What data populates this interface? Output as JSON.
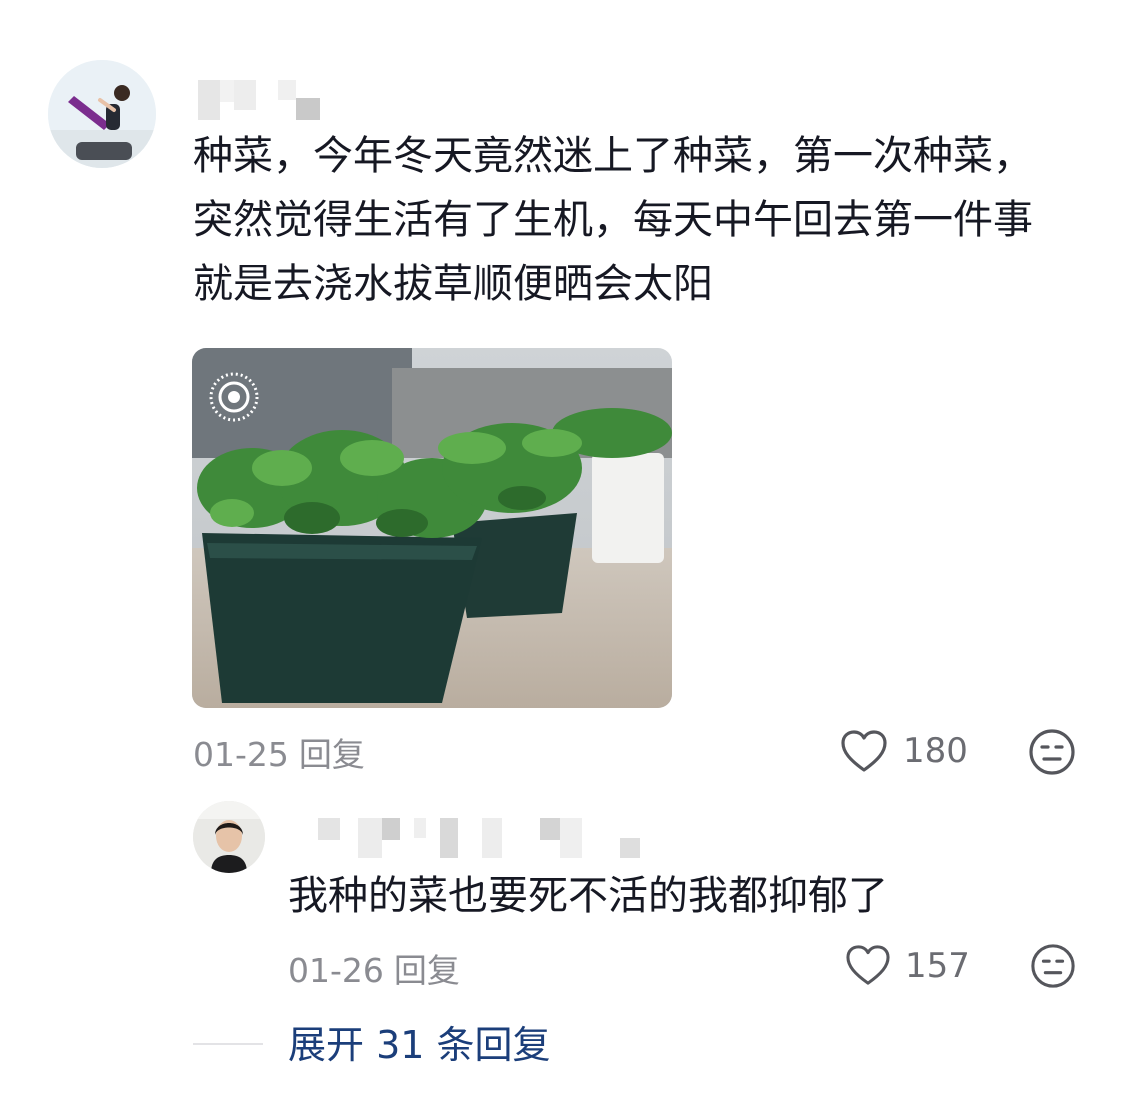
{
  "comment": {
    "text": "种菜，今年冬天竟然迷上了种菜，第一次种菜，突然觉得生活有了生机，每天中午回去第一件事就是去浇水拔草顺便晒会太阳",
    "date": "01-25",
    "reply_label": "回复",
    "likes": "180",
    "photo_badge_icon": "live-photo-icon",
    "heart_icon": "heart-outline-icon",
    "dislike_icon": "neutral-face-icon"
  },
  "reply": {
    "text": "我种的菜也要死不活的我都抑郁了",
    "date": "01-26",
    "reply_label": "回复",
    "likes": "157"
  },
  "expand": {
    "label": "展开 31 条回复"
  },
  "colors": {
    "link": "#1b3e7a",
    "meta": "#8a8b91",
    "text": "#161823"
  }
}
